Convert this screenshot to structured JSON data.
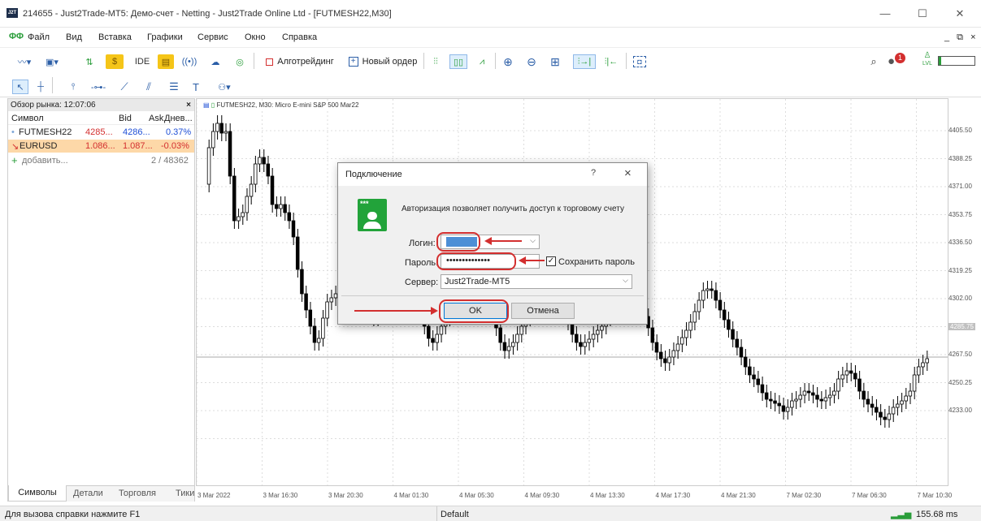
{
  "window": {
    "logo": "J2T",
    "title": "214655 - Just2Trade-MT5: Демо-счет - Netting - Just2Trade Online Ltd - [FUTMESH22,M30]",
    "min_icon": "minimize-icon",
    "max_icon": "maximize-icon",
    "close_icon": "close-icon"
  },
  "menu": {
    "items": [
      "Файл",
      "Вид",
      "Вставка",
      "Графики",
      "Сервис",
      "Окно",
      "Справка"
    ],
    "right_controls": "_ ⧉ ×"
  },
  "toolbar": {
    "ide_label": "IDE",
    "algo_label": "Алготрейдинг",
    "new_order_label": "Новый ордер",
    "notification_count": "1",
    "lvl_label": "LVL"
  },
  "market_watch": {
    "header": "Обзор рынка: 12:07:06",
    "close": "×",
    "columns": [
      "Символ",
      "Bid",
      "Ask",
      "Днев..."
    ],
    "rows": [
      {
        "symbol": "FUTMESH22",
        "bid": "4285...",
        "ask": "4286...",
        "change": "0.37%"
      },
      {
        "symbol": "EURUSD",
        "bid": "1.086...",
        "ask": "1.087...",
        "change": "-0.03%"
      }
    ],
    "add_label": "добавить...",
    "count": "2 / 48362",
    "tabs": [
      "Символы",
      "Детали",
      "Торговля",
      "Тики"
    ]
  },
  "chart": {
    "header": "FUTMESH22, M30:  Micro E-mini S&P 500 Mar22",
    "price_labels": [
      "4405.50",
      "4388.25",
      "4371.00",
      "4353.75",
      "4336.50",
      "4319.25",
      "4302.00",
      "4285.75",
      "4267.50",
      "4250.25",
      "4233.00"
    ],
    "current_price_label": "4285.75",
    "time_labels": [
      "3 Mar 2022",
      "3 Mar 16:30",
      "3 Mar 20:30",
      "4 Mar 01:30",
      "4 Mar 05:30",
      "4 Mar 09:30",
      "4 Mar 13:30",
      "4 Mar 17:30",
      "4 Mar 21:30",
      "7 Mar 02:30",
      "7 Mar 06:30",
      "7 Mar 10:30"
    ]
  },
  "dialog": {
    "title": "Подключение",
    "help": "?",
    "close": "×",
    "icon_text": "***",
    "message": "Авторизация позволяет получить доступ к торговому счету",
    "login_label": "Логин:",
    "password_label": "Пароль:",
    "password_value": "••••••••••••••",
    "save_password_label": "Сохранить пароль",
    "save_password_checked": true,
    "server_label": "Сервер:",
    "server_value": "Just2Trade-MT5",
    "ok_label": "OK",
    "cancel_label": "Отмена"
  },
  "status": {
    "help_text": "Для вызова справки нажмите F1",
    "profile": "Default",
    "ping": "155.68 ms"
  },
  "colors": {
    "annotation": "#d32f2f",
    "bid_red": "#d32f2f",
    "ask_blue": "#1e4fd6",
    "positive_blue": "#1e4fd6",
    "negative_red": "#d32f2f",
    "dialog_icon_green": "#22a33a"
  }
}
